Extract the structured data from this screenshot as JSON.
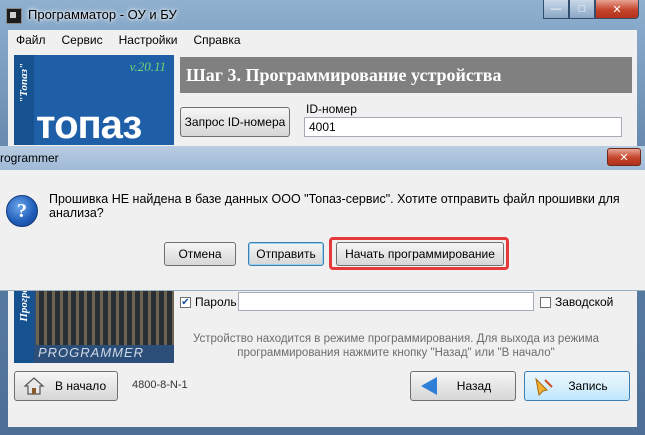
{
  "window": {
    "title": "Программатор - ОУ и БУ",
    "controls": {
      "minimize": "—",
      "maximize": "□",
      "close": "✕"
    }
  },
  "menu": [
    "Файл",
    "Сервис",
    "Настройки",
    "Справка"
  ],
  "banner": {
    "version": "v.20.11",
    "logo": "топаз",
    "vertical_text": "\"Топаз\"",
    "vertical_text2": "Програ",
    "programmer": "PROGRAMMER"
  },
  "step": {
    "title": "Шаг 3. Программирование устройства"
  },
  "id_request_button": "Запрос ID-номера",
  "id_field": {
    "label": "ID-номер",
    "value": "4001"
  },
  "password": {
    "label": "Пароль",
    "checked": true
  },
  "factory": {
    "label": "Заводской",
    "checked": false
  },
  "info_text": [
    "Устройство находится в режиме программирования. Для выхода из режима",
    "программирования нажмите кнопку \"Назад\" или \"В начало\""
  ],
  "status_code": "4800-8-N-1",
  "buttons": {
    "home": "В начало",
    "back": "Назад",
    "write": "Запись"
  },
  "dialog": {
    "title": "rogrammer",
    "message": "Прошивка НЕ найдена в базе данных ООО \"Топаз-сервис\". Хотите отправить файл прошивки для анализа?",
    "icon": "question-icon",
    "buttons": {
      "cancel": "Отмена",
      "send": "Отправить",
      "start": "Начать программирование"
    },
    "close": "✕"
  },
  "colors": {
    "highlight": "#e43a3a",
    "step_bar": "#808080",
    "banner": "#1f5fa8"
  }
}
